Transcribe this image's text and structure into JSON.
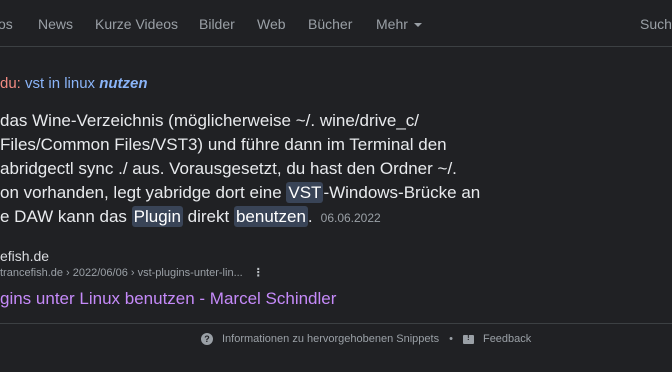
{
  "nav": {
    "tabs": [
      "os",
      "News",
      "Kurze Videos",
      "Bilder",
      "Web",
      "Bücher",
      "Mehr"
    ],
    "right_label": "Sucht"
  },
  "query": {
    "prefix": "du:",
    "text": "vst in linux",
    "emphasis": "nutzen"
  },
  "snippet": {
    "line1": "das Wine-Verzeichnis (möglicherweise ~/. wine/drive_c/",
    "line2": " Files/Common Files/VST3) und führe dann im Terminal den",
    "line3": "abridgectl sync ./ aus. Vorausgesetzt, du hast den Ordner ~/.",
    "line4_a": "on vorhanden, legt yabridge dort eine ",
    "line4_hl": "VST",
    "line4_b": "-Windows-Brücke an",
    "line5_a": "e DAW kann das ",
    "line5_hl1": "Plugin",
    "line5_b": " direkt ",
    "line5_hl2": "benutzen",
    "line5_c": ".",
    "date": "06.06.2022"
  },
  "source": {
    "name": "efish.de",
    "url": "trancefish.de › 2022/06/06 › vst-plugins-unter-lin...",
    "title": "gins unter Linux benutzen - Marcel Schindler"
  },
  "footer": {
    "info_text": "Informationen zu hervorgehobenen Snippets",
    "feedback": "Feedback"
  },
  "colors": {
    "background": "#202124",
    "link_title": "#c58af9",
    "highlight_bg": "#394457",
    "query_blue": "#8ab4f8"
  }
}
